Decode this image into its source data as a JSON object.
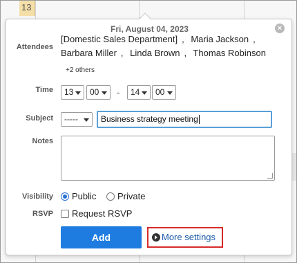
{
  "calendar": {
    "visible_day": "13"
  },
  "popup": {
    "title": "Fri, August 04, 2023",
    "close_icon": "close-icon"
  },
  "labels": {
    "attendees": "Attendees",
    "time": "Time",
    "subject": "Subject",
    "notes": "Notes",
    "visibility": "Visibility",
    "rsvp": "RSVP"
  },
  "attendees": {
    "items": [
      "[Domestic Sales Department]",
      "Maria Jackson",
      "Barbara Miller",
      "Linda Brown",
      "Thomas Robinson"
    ],
    "separator": ",",
    "more": "+2 others"
  },
  "time": {
    "start_hour": "13",
    "start_minute": "00",
    "separator": "-",
    "end_hour": "14",
    "end_minute": "00"
  },
  "subject": {
    "category": "-----",
    "value": "Business strategy meeting"
  },
  "notes": {
    "value": ""
  },
  "visibility": {
    "options": [
      "Public",
      "Private"
    ],
    "selected": "Public"
  },
  "rsvp": {
    "label": "Request RSVP",
    "checked": false
  },
  "buttons": {
    "add": "Add",
    "more_settings": "More settings"
  }
}
